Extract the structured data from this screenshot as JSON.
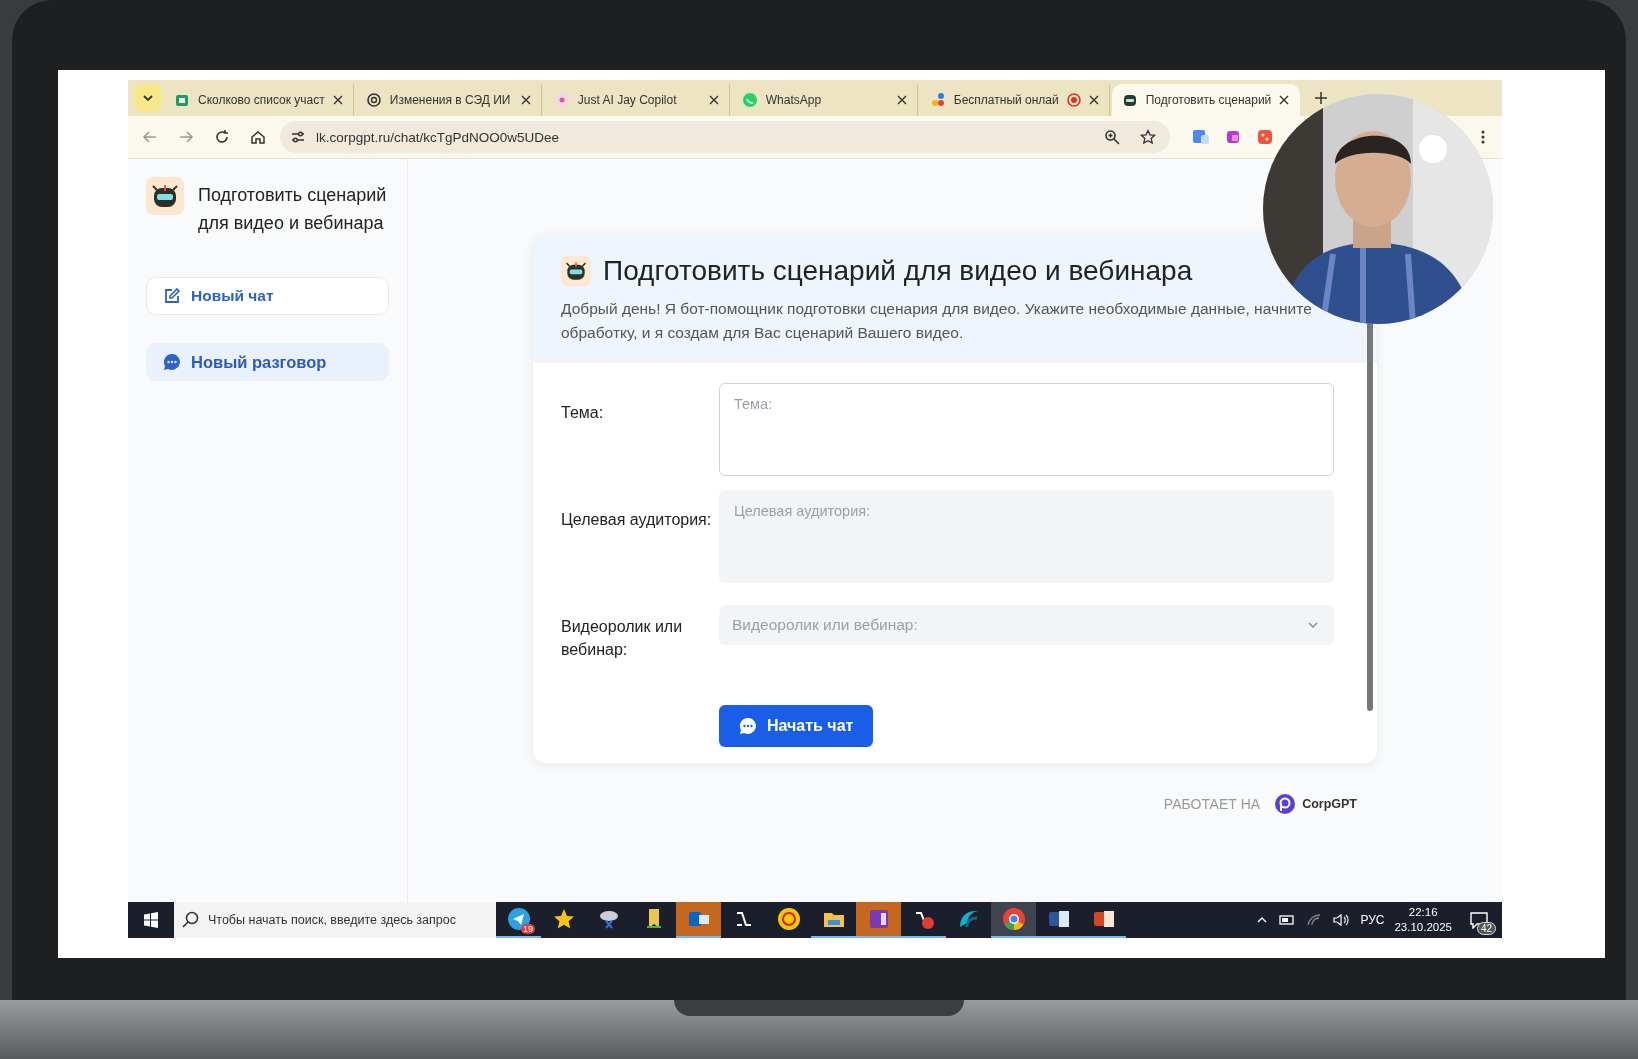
{
  "browser": {
    "tabs": [
      {
        "title": "Сколково список участ",
        "selected": false
      },
      {
        "title": "Изменения в СЭД ИИ",
        "selected": false
      },
      {
        "title": "Just AI Jay Copilot",
        "selected": false
      },
      {
        "title": "WhatsApp",
        "selected": false
      },
      {
        "title": "Бесплатный онлай",
        "selected": false
      },
      {
        "title": "Подготовить сценарий",
        "selected": true
      }
    ],
    "address": "lk.corpgpt.ru/chat/kcTgPdNOO0w5UDee"
  },
  "sidebar": {
    "title": "Подготовить сценарий для видео и вебинара",
    "items": [
      {
        "label": "Новый чат",
        "selected": false
      },
      {
        "label": "Новый разговор",
        "selected": true
      }
    ]
  },
  "card": {
    "title": "Подготовить сценарий для видео и вебинара",
    "description": "Добрый день! Я бот-помощник подготовки сценария для видео. Укажите необходимые данные, начните обработку, и я создам для Вас сценарий Вашего видео.",
    "fields": [
      {
        "kind": "textarea",
        "label": "Тема:",
        "placeholder": "Тема:",
        "focused": true
      },
      {
        "kind": "textarea",
        "label": "Целевая аудитория:",
        "placeholder": "Целевая аудитория:",
        "focused": false
      },
      {
        "kind": "select",
        "label": "Видеоролик или вебинар:",
        "placeholder": "Видеоролик или вебинар:",
        "focused": false
      }
    ],
    "button": "Начать чат"
  },
  "footer": {
    "powered_by": "РАБОТАЕТ НА",
    "brand": "CorpGPT"
  },
  "taskbar": {
    "search": {
      "placeholder": "Чтобы начать поиск, введите здесь запрос"
    },
    "apps": [
      {
        "running": true,
        "attention": false,
        "selected": false,
        "badge": "19"
      },
      {
        "running": false,
        "attention": false,
        "selected": false
      },
      {
        "running": false,
        "attention": false,
        "selected": false
      },
      {
        "running": false,
        "attention": false,
        "selected": false
      },
      {
        "running": true,
        "attention": true,
        "selected": false
      },
      {
        "running": false,
        "attention": false,
        "selected": false
      },
      {
        "running": false,
        "attention": false,
        "selected": false
      },
      {
        "running": true,
        "attention": false,
        "selected": false
      },
      {
        "running": true,
        "attention": true,
        "selected": false
      },
      {
        "running": true,
        "attention": false,
        "selected": false
      },
      {
        "running": false,
        "attention": false,
        "selected": false
      },
      {
        "running": true,
        "attention": false,
        "selected": true
      },
      {
        "running": true,
        "attention": false,
        "selected": false
      },
      {
        "running": true,
        "attention": false,
        "selected": false
      }
    ],
    "language": "РУС",
    "time": "22:16",
    "date": "23.10.2025",
    "notifications": "42"
  }
}
